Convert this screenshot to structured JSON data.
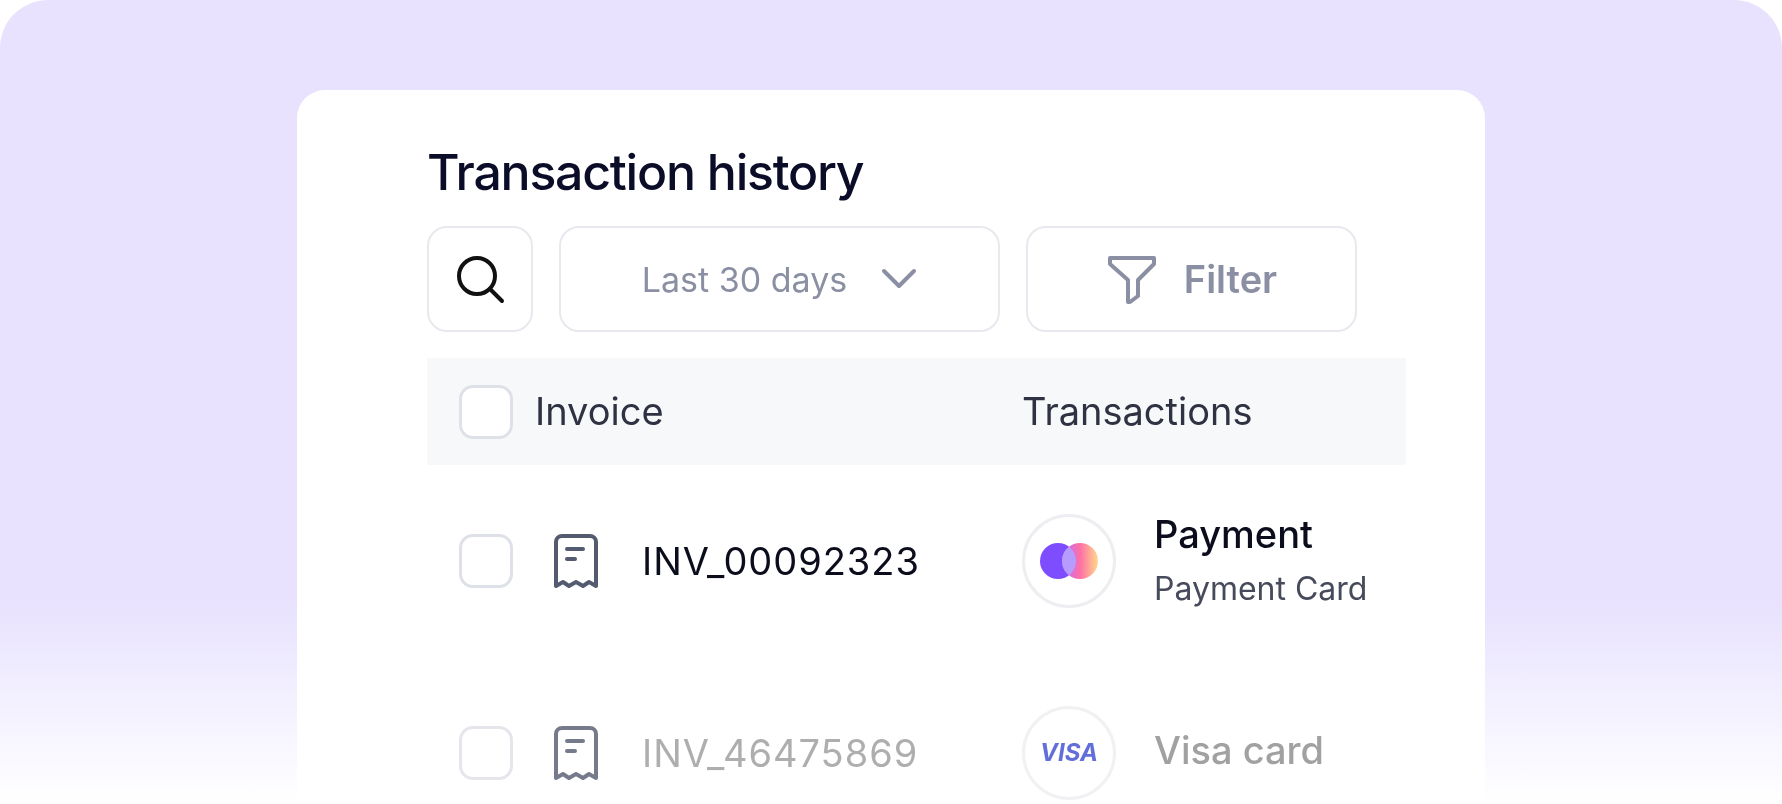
{
  "title": "Transaction history",
  "toolbar": {
    "date_range": "Last 30 days",
    "filter": "Filter"
  },
  "table": {
    "columns": [
      "Invoice",
      "Transactions"
    ],
    "header_checked": false,
    "rows": [
      {
        "invoice": "INV_00092323",
        "checked": false,
        "method": "Payment",
        "kind": "circles",
        "subtitle": "Payment Card"
      },
      {
        "invoice": "INV_46475869",
        "checked": false,
        "method": "Visa card",
        "kind": "wordmark",
        "logo_text": "VISA"
      }
    ]
  }
}
